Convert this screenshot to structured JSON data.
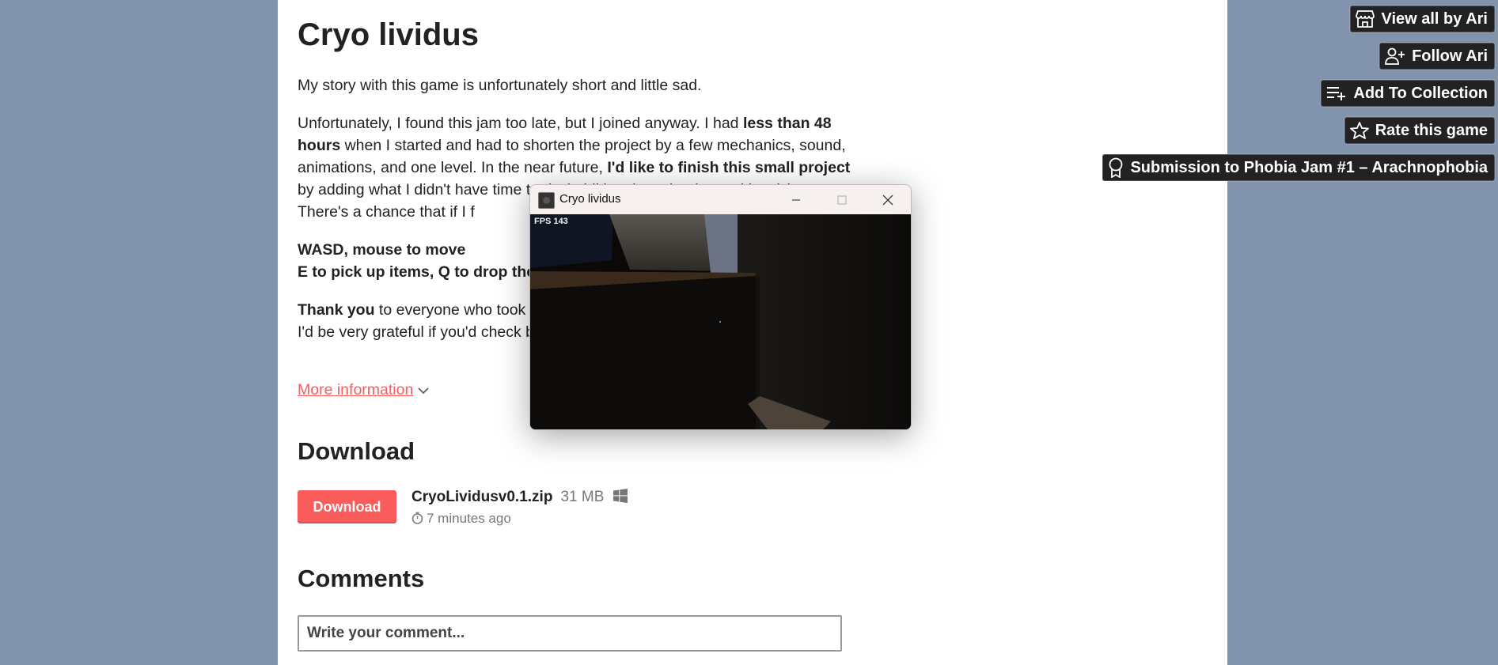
{
  "page": {
    "title": "Cryo lividus",
    "description": {
      "p1": "My story with this game is unfortunately short and little sad.",
      "p2": [
        {
          "t": "Unfortunately, I found this jam too late, but I joined anyway. I had ",
          "b": false
        },
        {
          "t": "less than 48 hours",
          "b": true
        },
        {
          "t": " when I started and had to shorten the project by a few mechanics, sound, animations, and one level. In the near future, ",
          "b": false
        },
        {
          "t": "I'd like to finish this small project",
          "b": true
        },
        {
          "t": " by adding what I didn't have time to do (additional mechanics and levels). There's a chance that if I f",
          "b": false
        }
      ],
      "p3_line1": "WASD, mouse to move",
      "p3_line2": "E to pick up items, Q to drop them",
      "p4": [
        {
          "t": "Thank you",
          "b": true
        },
        {
          "t": " to everyone who took t",
          "b": false
        },
        {
          "t": "\nI'd be very grateful if you'd check b",
          "b": false
        }
      ]
    },
    "more_info": "More information",
    "download_heading": "Download",
    "download_button": "Download",
    "file": {
      "name": "CryoLividusv0.1.zip",
      "size": "31 MB",
      "platform_icon": "windows-icon",
      "time": "7 minutes ago"
    },
    "comments_heading": "Comments",
    "comment_placeholder": "Write your comment..."
  },
  "sidebar": {
    "buttons": [
      {
        "label": "View all by Ari",
        "icon": "store-icon"
      },
      {
        "label": "Follow Ari",
        "icon": "user-plus-icon"
      },
      {
        "label": "Add To Collection",
        "icon": "playlist-add-icon"
      },
      {
        "label": "Rate this game",
        "icon": "star-icon"
      },
      {
        "label": "Submission to Phobia Jam #1 – Arachnophobia",
        "icon": "ribbon-icon"
      }
    ]
  },
  "game_window": {
    "title": "Cryo lividus",
    "fps": "FPS 143"
  },
  "colors": {
    "background": "#8293ae",
    "accent": "#fa5c5c",
    "sidebar_button": "#222222"
  }
}
